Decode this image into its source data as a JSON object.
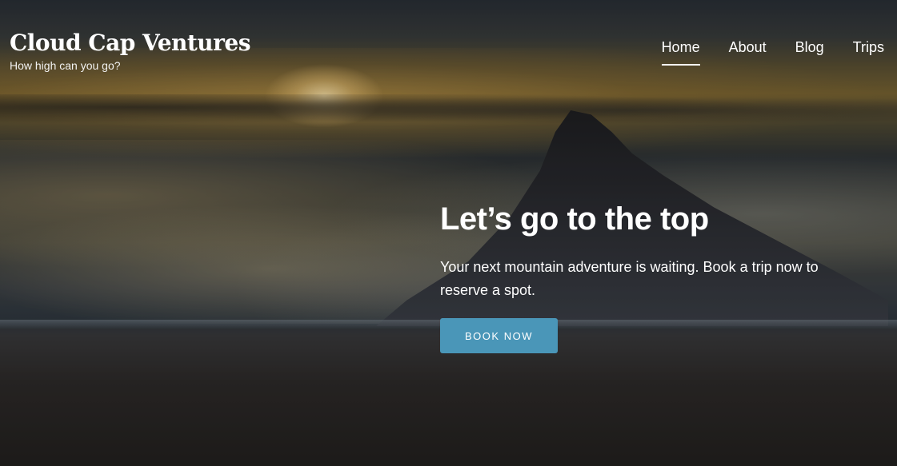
{
  "brand": {
    "title": "Cloud Cap Ventures",
    "tagline": "How high can you go?"
  },
  "nav": {
    "items": [
      {
        "label": "Home",
        "active": true
      },
      {
        "label": "About",
        "active": false
      },
      {
        "label": "Blog",
        "active": false
      },
      {
        "label": "Trips",
        "active": false
      }
    ]
  },
  "hero": {
    "headline": "Let’s go to the top",
    "subtext": "Your next mountain adventure is waiting. Book a trip now to reserve a spot.",
    "cta_label": "BOOK NOW"
  },
  "colors": {
    "accent": "#4a96b8",
    "text": "#ffffff"
  }
}
